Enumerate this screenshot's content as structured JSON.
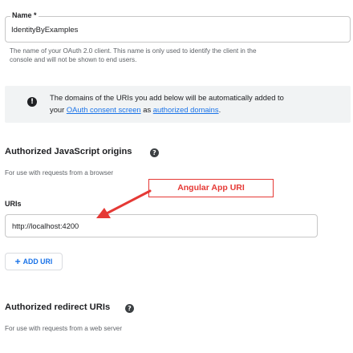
{
  "name_field": {
    "label": "Name *",
    "value": "IdentityByExamples",
    "hint_line1": "The name of your OAuth 2.0 client. This name is only used to identify the client in the",
    "hint_line2": "console and will not be shown to end users."
  },
  "info_banner": {
    "icon": "info-icon",
    "text_line1": "The domains of the URIs you add below will be automatically added to",
    "text_prefix": "your",
    "consent_link": "OAuth consent screen",
    "text_middle": "as",
    "domains_link": "authorized domains",
    "text_suffix": "."
  },
  "js_origins": {
    "title": "Authorized JavaScript origins",
    "help_icon": "help-icon",
    "subtitle": "For use with requests from a browser",
    "uris_label": "URIs",
    "uri_value": "http://localhost:4200",
    "add_button_label": "ADD URI",
    "add_button_icon": "plus-icon"
  },
  "annotation": {
    "callout_text": "Angular App URI",
    "color": "#e53935"
  },
  "redirect_uris": {
    "title": "Authorized redirect URIs",
    "help_icon": "help-icon",
    "subtitle": "For use with requests from a web server"
  },
  "colors": {
    "link": "#1a73e8",
    "banner_bg": "#f1f3f4",
    "text": "#202124",
    "hint": "#5f6368",
    "border": "#c7c7c7"
  }
}
